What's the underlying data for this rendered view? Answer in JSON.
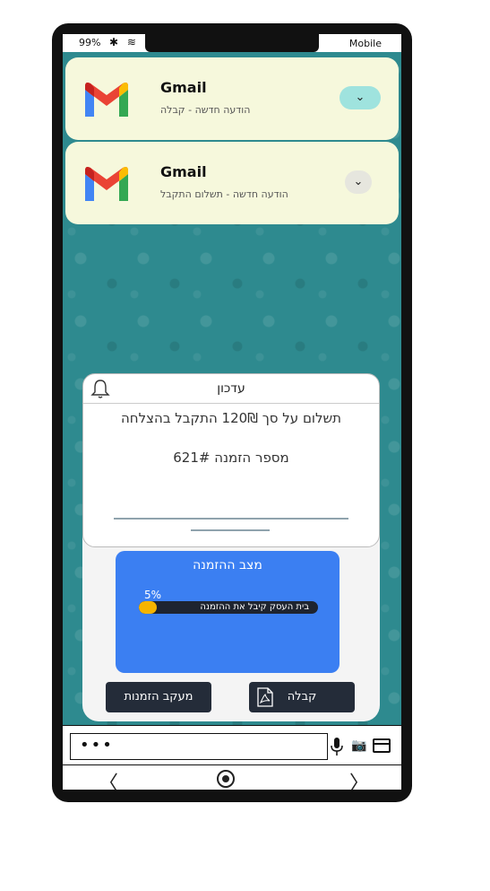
{
  "status_bar": {
    "battery": "99%",
    "icons": "✱ ≋",
    "carrier": "Mobile"
  },
  "notifications": [
    {
      "app": "Gmail",
      "message": "הודעה חדשה - קבלה",
      "expand_icon": "chevron-down-icon"
    },
    {
      "app": "Gmail",
      "message": "הודעה חדשה - תשלום התקבל",
      "expand_icon": "chevron-down-icon"
    }
  ],
  "update_card": {
    "title": "עדכון",
    "line1": "תשלום על סך 120₪ התקבל בהצלחה",
    "line2": "מספר הזמנה 621#"
  },
  "order_status": {
    "title": "מצב ההזמנה",
    "progress_label": "5%",
    "progress": 0.05,
    "bar_text": "בית העסק קיבל את ההזמנה"
  },
  "buttons": {
    "track_orders": "מעקב הזמנות",
    "receipt": "קבלה"
  },
  "input_bar": {
    "placeholder_dots": "•••"
  },
  "colors": {
    "status_blue": "#3b7ff2",
    "progress_yellow": "#f5b400",
    "wallpaper": "#2e8a8f",
    "notification_bg": "#f6f8dc"
  }
}
